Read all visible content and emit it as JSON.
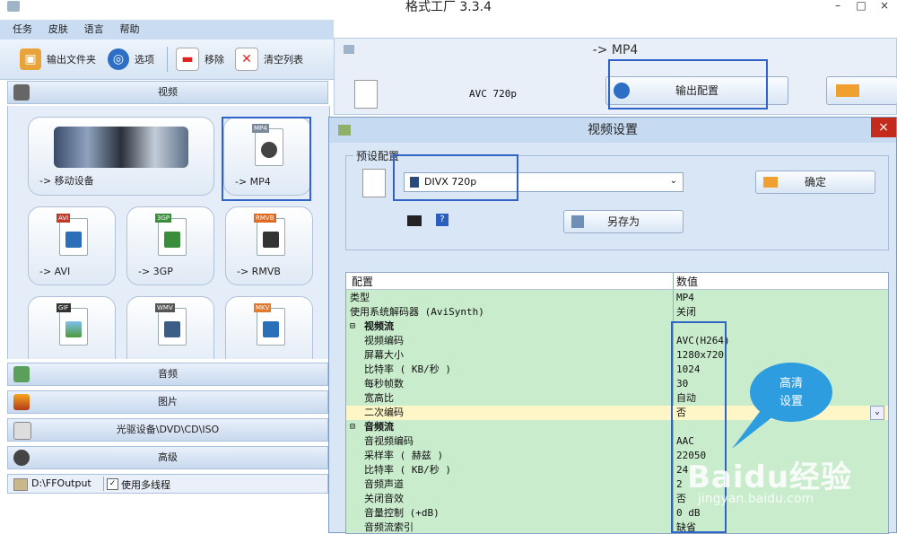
{
  "app": {
    "title": "格式工厂 3.3.4",
    "window_buttons": [
      "–",
      "□",
      "×"
    ]
  },
  "menu": [
    "任务",
    "皮肤",
    "语言",
    "帮助"
  ],
  "toolbar": [
    {
      "label": "输出文件夹",
      "icon": "folder-icon"
    },
    {
      "label": "选项",
      "icon": "options-icon"
    },
    {
      "label": "移除",
      "icon": "remove-icon"
    },
    {
      "label": "清空列表",
      "icon": "clear-list-icon"
    }
  ],
  "left_panel": {
    "video_section": "视频",
    "tiles": [
      {
        "label": "-> 移动设备",
        "badge": ""
      },
      {
        "label": "-> MP4",
        "badge": "MP4"
      },
      {
        "label": "-> AVI",
        "badge": "AVI"
      },
      {
        "label": "-> 3GP",
        "badge": "3GP"
      },
      {
        "label": "-> RMVB",
        "badge": "RMVB"
      },
      {
        "label": "",
        "badge": "GIF"
      },
      {
        "label": "",
        "badge": "WMV"
      },
      {
        "label": "",
        "badge": "MKV"
      }
    ],
    "sections": [
      "音频",
      "图片",
      "光驱设备\\DVD\\CD\\ISO",
      "高级"
    ],
    "status": {
      "output_path": "D:\\FFOutput",
      "multithread_label": "使用多线程",
      "multithread_checked": true
    }
  },
  "mp4_window": {
    "title": "-> MP4",
    "preset_text": "AVC 720p",
    "output_config_button": "输出配置"
  },
  "video_settings_dialog": {
    "title": "视频设置",
    "close": "×",
    "preset_group": "预设配置",
    "selected_preset": "DIVX 720p",
    "ok_button": "确定",
    "save_as_button": "另存为",
    "table_headers": [
      "配置",
      "数值"
    ],
    "rows": [
      {
        "key": "类型",
        "value": "MP4",
        "indent": 0,
        "group": false
      },
      {
        "key": "使用系统解码器 (AviSynth)",
        "value": "关闭",
        "indent": 0,
        "group": false
      },
      {
        "key": "视频流",
        "value": "",
        "indent": 0,
        "group": true
      },
      {
        "key": "视频编码",
        "value": "AVC(H264)",
        "indent": 1,
        "group": false
      },
      {
        "key": "屏幕大小",
        "value": "1280x720",
        "indent": 1,
        "group": false
      },
      {
        "key": "比特率 ( KB/秒 )",
        "value": "1024",
        "indent": 1,
        "group": false
      },
      {
        "key": "每秒帧数",
        "value": "30",
        "indent": 1,
        "group": false
      },
      {
        "key": "宽高比",
        "value": "自动",
        "indent": 1,
        "group": false
      },
      {
        "key": "二次编码",
        "value": "否",
        "indent": 1,
        "group": false,
        "selected": true
      },
      {
        "key": "音频流",
        "value": "",
        "indent": 0,
        "group": true
      },
      {
        "key": "音视频编码",
        "value": "AAC",
        "indent": 1,
        "group": false
      },
      {
        "key": "采样率 ( 赫兹 )",
        "value": "22050",
        "indent": 1,
        "group": false
      },
      {
        "key": "比特率 ( KB/秒 )",
        "value": "24",
        "indent": 1,
        "group": false
      },
      {
        "key": "音频声道",
        "value": "2",
        "indent": 1,
        "group": false
      },
      {
        "key": "关闭音效",
        "value": "否",
        "indent": 1,
        "group": false
      },
      {
        "key": "音量控制 (+dB)",
        "value": "0 dB",
        "indent": 1,
        "group": false
      },
      {
        "key": "音频流索引",
        "value": "缺省",
        "indent": 1,
        "group": false
      }
    ]
  },
  "annotation": {
    "callout": "高清\n设置"
  },
  "watermark": {
    "brand": "Baidu经验",
    "url": "jingyan.baidu.com"
  },
  "colors": {
    "highlight": "#2f63c6",
    "table_bg": "#c9eccd",
    "callout": "#2d9de0",
    "close": "#c42b1c"
  }
}
